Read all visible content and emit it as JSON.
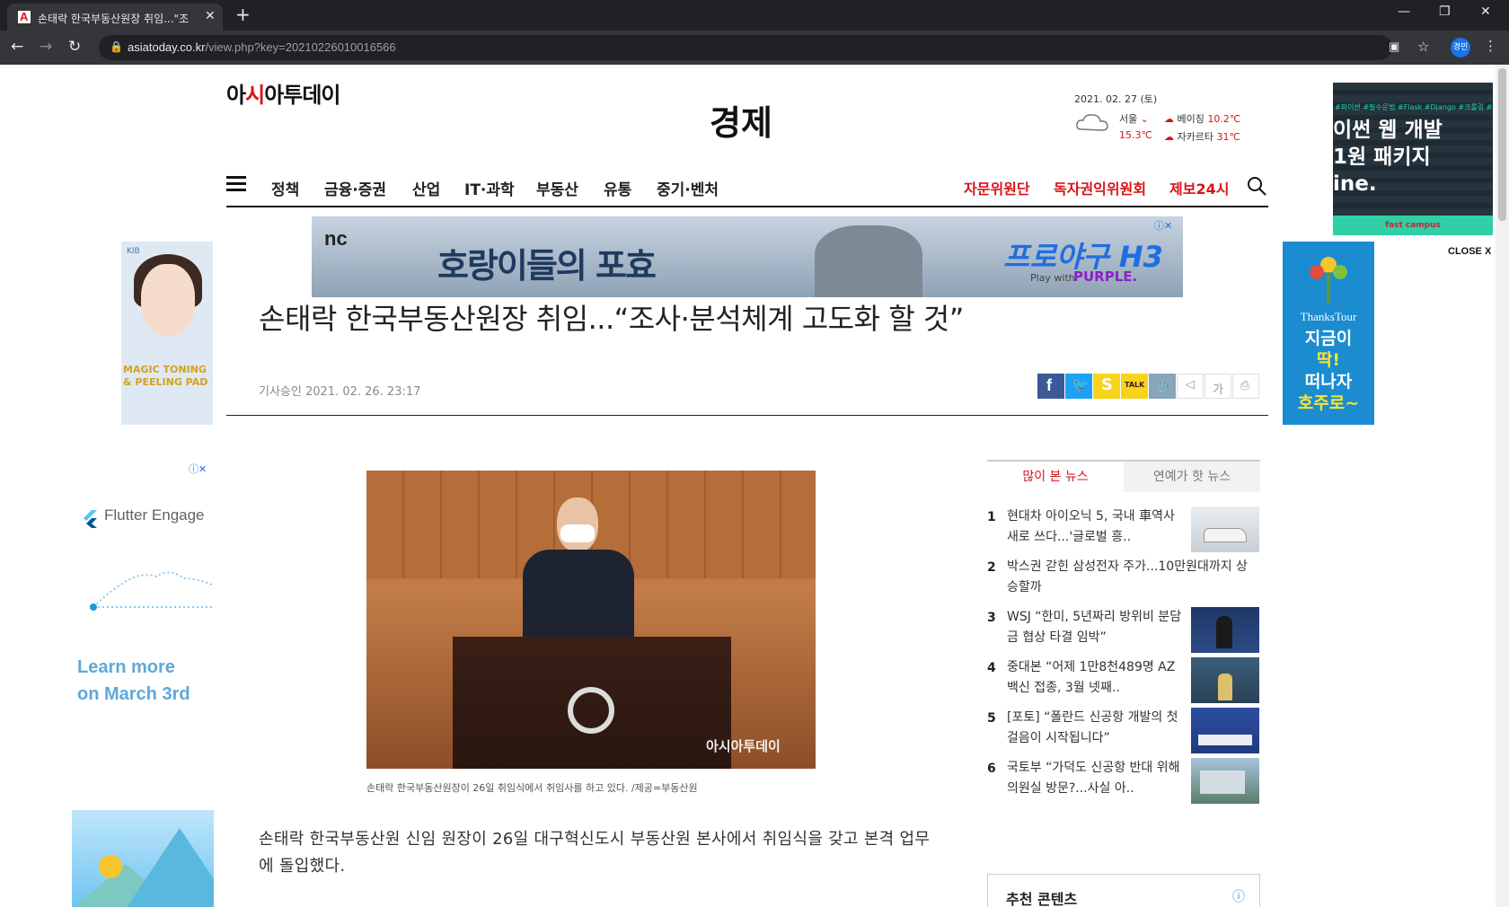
{
  "browser": {
    "tab_title": "손태락 한국부동산원장 취임...\"조",
    "tab_close": "✕",
    "new_tab": "+",
    "url_host": "asiatoday.co.kr",
    "url_path": "/view.php?key=20210226010016566",
    "profile_label": "경민",
    "win_min": "—",
    "win_max": "❐",
    "win_close": "✕"
  },
  "header": {
    "logo_pre": "아",
    "logo_mark": "시",
    "logo_post": "아투데이",
    "section": "경제",
    "date": "2021. 02. 27 (토)",
    "weather": {
      "city": "서울",
      "city_temp": "15.3℃",
      "beijing": "베이징",
      "beijing_temp": "10.2℃",
      "jakarta": "자카르타",
      "jakarta_temp": "31℃"
    }
  },
  "nav": {
    "items": [
      "정책",
      "금융·증권",
      "산업",
      "IT·과학",
      "부동산",
      "유통",
      "중기·벤처"
    ],
    "red_items": [
      "자문위원단",
      "독자권익위원회",
      "제보24시"
    ]
  },
  "ads": {
    "top_banner": {
      "brand": "nc",
      "title": "호랑이들의 포효",
      "game": "프로야구 H3",
      "play_with": "Play with",
      "purple": "PURPLE."
    },
    "left_top": {
      "brand": "KIB",
      "tag": "MAGIC TONING & PEELING PAD"
    },
    "right_top": {
      "brand": "ThanksTour",
      "line1": "지금이",
      "line2": "딱!",
      "line3": "떠나자",
      "line4": "호주로~"
    },
    "float": {
      "tags": "#파이썬 #필수문법 #Flask #Django #크롤링 #실전",
      "line1": "이썬 웹 개발",
      "line2": "1원 패키지",
      "line3": "ine.",
      "foot": "fast campus",
      "close": "CLOSE X"
    },
    "left_bottom": {
      "brand": "Flutter Engage",
      "line1": "Learn more",
      "line2": "on March 3rd"
    }
  },
  "article": {
    "headline": "손태락 한국부동산원장 취임...“조사·분석체계 고도화 할 것”",
    "approved": "기사승인 2021. 02. 26. 23:17",
    "photo_watermark": "아시아투데이",
    "caption": "손태락 한국부동산원장이 26일 취임식에서 취임사를 하고 있다. /제공=부동산원",
    "body": "손태락 한국부동산원 신임 원장이 26일 대구혁신도시 부동산원 본사에서 취임식을 갖고 본격 업무에 돌입했다."
  },
  "share": {
    "font_label": "가",
    "talk_label": "TALK"
  },
  "sidebar": {
    "tab_popular": "많이 본 뉴스",
    "tab_ent": "연예가 핫 뉴스",
    "news": [
      {
        "num": "1",
        "text": "현대차 아이오닉 5, 국내 車역사 새로 쓰다...'글로벌 흥.."
      },
      {
        "num": "2",
        "text": "박스권 갇힌 삼성전자 주가...10만원대까지 상승할까"
      },
      {
        "num": "3",
        "text": "WSJ “한미, 5년짜리 방위비 분담금 협상 타결 임박”"
      },
      {
        "num": "4",
        "text": "중대본 “어제 1만8천489명 AZ백신 접종, 3월 넷째.."
      },
      {
        "num": "5",
        "text": "[포토] “폴란드 신공항 개발의 첫 걸음이 시작됩니다”"
      },
      {
        "num": "6",
        "text": "국토부 “가덕도 신공항 반대 위해 의원실 방문?...사실 아.."
      }
    ],
    "recommend": "추천 콘텐츠"
  }
}
